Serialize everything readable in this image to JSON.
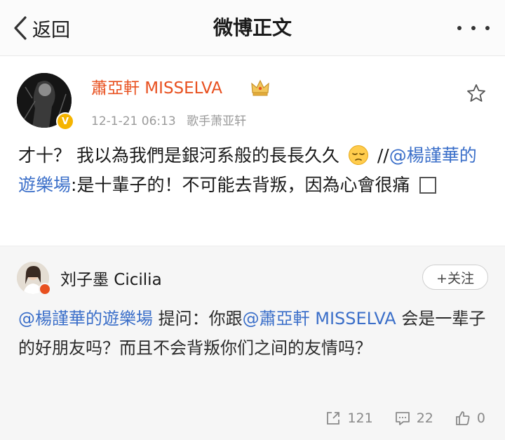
{
  "header": {
    "back_label": "返回",
    "title": "微博正文",
    "more_icon": "more-dots-icon"
  },
  "post": {
    "author": "蕭亞軒 MISSELVA",
    "verified_badge": "V",
    "date": "12-1-21 06:13",
    "source": "歌手萧亚轩",
    "text_1": "才十？ 我以為我們是銀河系般的長長久久",
    "emoji": "pensive-face-icon",
    "text_2": " //",
    "mention_1": "@楊謹華的遊樂場",
    "text_3": ":是十輩子的！不可能去背叛，因為心會很痛",
    "colors": {
      "name": "#e8501f",
      "link": "#3b6fc9",
      "meta": "#9a9a9a"
    }
  },
  "repost": {
    "author": "刘子墨 Cicilia",
    "follow_label": "+关注",
    "mention_1": "@楊謹華的遊樂場",
    "text_1": " 提问：你跟",
    "mention_2": "@蕭亞軒 MISSELVA",
    "text_2": " 会是一辈子的好朋友吗？而且不会背叛你们之间的友情吗？"
  },
  "actions": {
    "repost_count": "121",
    "comment_count": "22",
    "like_count": "0"
  }
}
